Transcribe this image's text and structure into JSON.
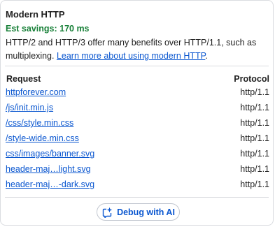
{
  "title": "Modern HTTP",
  "savings": "Est savings: 170 ms",
  "description": {
    "text": "HTTP/2 and HTTP/3 offer many benefits over HTTP/1.1, such as multiplexing. ",
    "link": "Learn more about using modern HTTP",
    "trail": "."
  },
  "table": {
    "headers": {
      "request": "Request",
      "protocol": "Protocol"
    },
    "rows": [
      {
        "request": "httpforever.com",
        "protocol": "http/1.1"
      },
      {
        "request": "/js/init.min.js",
        "protocol": "http/1.1"
      },
      {
        "request": "/css/style.min.css",
        "protocol": "http/1.1"
      },
      {
        "request": "/style-wide.min.css",
        "protocol": "http/1.1"
      },
      {
        "request": "css/images/banner.svg",
        "protocol": "http/1.1"
      },
      {
        "request": "header-maj…light.svg",
        "protocol": "http/1.1"
      },
      {
        "request": "header-maj…-dark.svg",
        "protocol": "http/1.1"
      }
    ]
  },
  "debug_button": {
    "label": "Debug with AI",
    "icon": "ai-sparkle-icon"
  }
}
